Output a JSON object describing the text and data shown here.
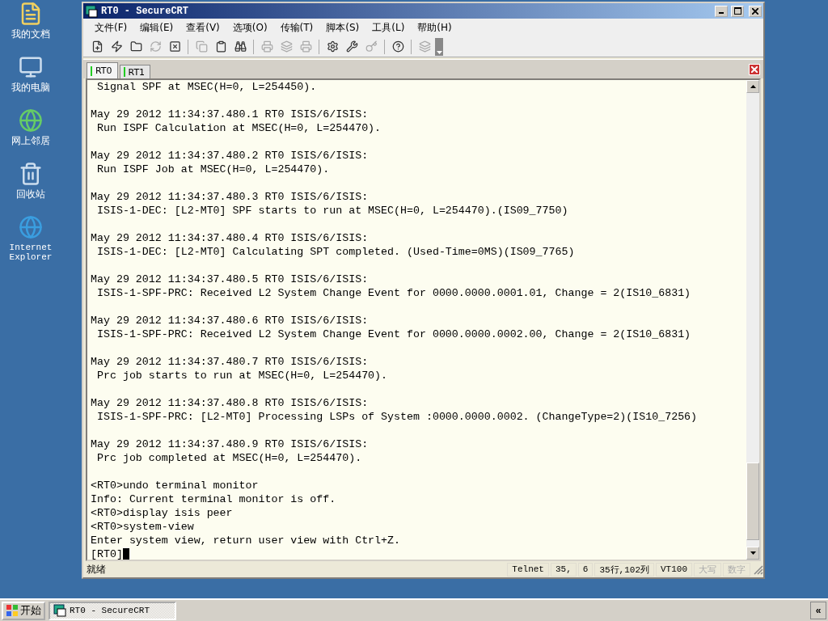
{
  "desktop_icons": [
    {
      "label": "我的文档",
      "kind": "documents"
    },
    {
      "label": "我的电脑",
      "kind": "computer"
    },
    {
      "label": "网上邻居",
      "kind": "network"
    },
    {
      "label": "回收站",
      "kind": "recycle"
    },
    {
      "label": "Internet Explorer",
      "kind": "browser"
    }
  ],
  "window": {
    "title": "RT0 - SecureCRT"
  },
  "menu": [
    "文件(F)",
    "编辑(E)",
    "查看(V)",
    "选项(O)",
    "传输(T)",
    "脚本(S)",
    "工具(L)",
    "帮助(H)"
  ],
  "toolbar": [
    {
      "disabled": false
    },
    {
      "disabled": false
    },
    {
      "disabled": false
    },
    {
      "disabled": true
    },
    {
      "disabled": false
    },
    {
      "disabled": true
    },
    {
      "disabled": false
    },
    {
      "disabled": false
    },
    {
      "disabled": true
    },
    {
      "disabled": true
    },
    {
      "disabled": true
    },
    {
      "disabled": false
    },
    {
      "disabled": false
    },
    {
      "disabled": true
    },
    {
      "disabled": false
    },
    {
      "disabled": true
    }
  ],
  "tabs": [
    {
      "label": "RT0",
      "selected": true
    },
    {
      "label": "RT1",
      "selected": false
    }
  ],
  "terminal": {
    "blocks": [
      {
        "lines": [
          " Signal SPF at MSEC(H=0, L=254450)."
        ]
      },
      {
        "lines": [
          "May 29 2012 11:34:37.480.1 RT0 ISIS/6/ISIS:",
          " Run ISPF Calculation at MSEC(H=0, L=254470)."
        ]
      },
      {
        "lines": [
          "May 29 2012 11:34:37.480.2 RT0 ISIS/6/ISIS:",
          " Run ISPF Job at MSEC(H=0, L=254470)."
        ]
      },
      {
        "lines": [
          "May 29 2012 11:34:37.480.3 RT0 ISIS/6/ISIS:",
          " ISIS-1-DEC: [L2-MT0] SPF starts to run at MSEC(H=0, L=254470).(IS09_7750)"
        ]
      },
      {
        "lines": [
          "May 29 2012 11:34:37.480.4 RT0 ISIS/6/ISIS:",
          " ISIS-1-DEC: [L2-MT0] Calculating SPT completed. (Used-Time=0MS)(IS09_7765)"
        ]
      },
      {
        "lines": [
          "May 29 2012 11:34:37.480.5 RT0 ISIS/6/ISIS:",
          " ISIS-1-SPF-PRC: Received L2 System Change Event for 0000.0000.0001.01, Change = 2(IS10_6831)"
        ]
      },
      {
        "lines": [
          "May 29 2012 11:34:37.480.6 RT0 ISIS/6/ISIS:",
          " ISIS-1-SPF-PRC: Received L2 System Change Event for 0000.0000.0002.00, Change = 2(IS10_6831)"
        ]
      },
      {
        "lines": [
          "May 29 2012 11:34:37.480.7 RT0 ISIS/6/ISIS:",
          " Prc job starts to run at MSEC(H=0, L=254470)."
        ]
      },
      {
        "lines": [
          "May 29 2012 11:34:37.480.8 RT0 ISIS/6/ISIS:",
          " ISIS-1-SPF-PRC: [L2-MT0] Processing LSPs of System :0000.0000.0002. (ChangeType=2)(IS10_7256)"
        ]
      },
      {
        "lines": [
          "May 29 2012 11:34:37.480.9 RT0 ISIS/6/ISIS:",
          " Prc job completed at MSEC(H=0, L=254470)."
        ]
      },
      {
        "lines": [
          "<RT0>undo terminal monitor",
          "Info: Current terminal monitor is off.",
          "<RT0>display isis peer",
          "<RT0>system-view",
          "Enter system view, return user view with Ctrl+Z.",
          "[RT0]"
        ]
      }
    ]
  },
  "status_bar": {
    "message": "就绪",
    "panes": [
      {
        "text": "Telnet",
        "disabled": false
      },
      {
        "text": "35,",
        "disabled": false
      },
      {
        "text": "6",
        "disabled": false
      },
      {
        "text": "35行,102列",
        "disabled": false
      },
      {
        "text": "VT100",
        "disabled": false
      },
      {
        "text": "大写",
        "disabled": true
      },
      {
        "text": "数字",
        "disabled": true
      }
    ]
  },
  "taskbar": {
    "start": "开始",
    "tasks": [
      {
        "label": "RT0 - SecureCRT",
        "selected": true
      }
    ],
    "tray_toggle": "«"
  }
}
